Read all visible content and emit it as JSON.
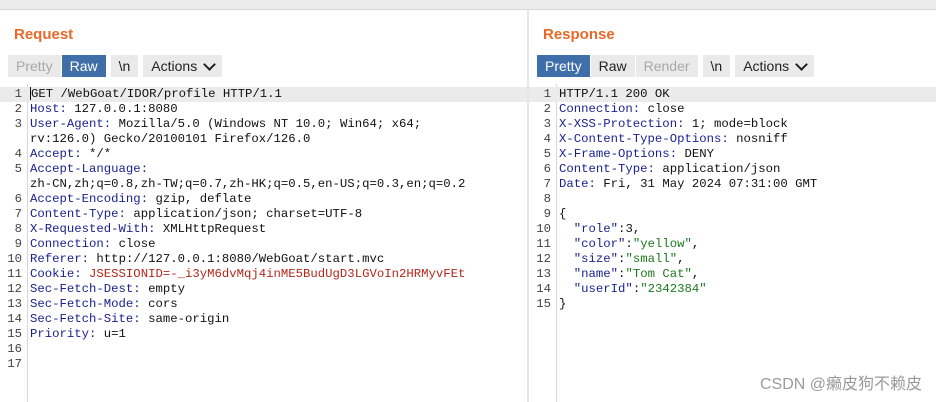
{
  "request": {
    "title": "Request",
    "tabs": [
      "Pretty",
      "Raw"
    ],
    "newline_button": "\\n",
    "actions_label": "Actions",
    "lines": [
      {
        "n": "1",
        "text": "GET /WebGoat/IDOR/profile HTTP/1.1"
      },
      {
        "n": "2",
        "key": "Host:",
        "val": " 127.0.0.1:8080"
      },
      {
        "n": "3",
        "key": "User-Agent:",
        "val": " Mozilla/5.0 (Windows NT 10.0; Win64; x64;"
      },
      {
        "n": "",
        "text": "rv:126.0) Gecko/20100101 Firefox/126.0"
      },
      {
        "n": "4",
        "key": "Accept:",
        "val": " */*"
      },
      {
        "n": "5",
        "key": "Accept-Language:",
        "val": ""
      },
      {
        "n": "",
        "text": "zh-CN,zh;q=0.8,zh-TW;q=0.7,zh-HK;q=0.5,en-US;q=0.3,en;q=0.2"
      },
      {
        "n": "6",
        "key": "Accept-Encoding:",
        "val": " gzip, deflate"
      },
      {
        "n": "7",
        "key": "Content-Type:",
        "val": " application/json; charset=UTF-8"
      },
      {
        "n": "8",
        "key": "X-Requested-With:",
        "val": " XMLHttpRequest"
      },
      {
        "n": "9",
        "key": "Connection:",
        "val": " close"
      },
      {
        "n": "10",
        "key": "Referer:",
        "val": " http://127.0.0.1:8080/WebGoat/start.mvc"
      },
      {
        "n": "11",
        "key": "Cookie:",
        "cookie": " JSESSIONID=-_i3yM6dvMqj4inME5BudUgD3LGVoIn2HRMyvFEt"
      },
      {
        "n": "12",
        "key": "Sec-Fetch-Dest:",
        "val": " empty"
      },
      {
        "n": "13",
        "key": "Sec-Fetch-Mode:",
        "val": " cors"
      },
      {
        "n": "14",
        "key": "Sec-Fetch-Site:",
        "val": " same-origin"
      },
      {
        "n": "15",
        "key": "Priority:",
        "val": " u=1"
      },
      {
        "n": "16",
        "text": ""
      },
      {
        "n": "17",
        "text": ""
      }
    ]
  },
  "response": {
    "title": "Response",
    "tabs": [
      "Pretty",
      "Raw",
      "Render"
    ],
    "newline_button": "\\n",
    "actions_label": "Actions",
    "lines": [
      {
        "n": "1",
        "text": "HTTP/1.1 200 OK"
      },
      {
        "n": "2",
        "key": "Connection:",
        "val": " close"
      },
      {
        "n": "3",
        "key": "X-XSS-Protection:",
        "val": " 1; mode=block"
      },
      {
        "n": "4",
        "key": "X-Content-Type-Options:",
        "val": " nosniff"
      },
      {
        "n": "5",
        "key": "X-Frame-Options:",
        "val": " DENY"
      },
      {
        "n": "6",
        "key": "Content-Type:",
        "val": " application/json"
      },
      {
        "n": "7",
        "key": "Date:",
        "val": " Fri, 31 May 2024 07:31:00 GMT"
      },
      {
        "n": "8",
        "text": ""
      },
      {
        "n": "9",
        "text": "{"
      },
      {
        "n": "10",
        "jkey": "\"role\"",
        "jpunct": ":",
        "jnum": "3",
        "tail": ","
      },
      {
        "n": "11",
        "jkey": "\"color\"",
        "jpunct": ":",
        "jstr": "\"yellow\"",
        "tail": ","
      },
      {
        "n": "12",
        "jkey": "\"size\"",
        "jpunct": ":",
        "jstr": "\"small\"",
        "tail": ","
      },
      {
        "n": "13",
        "jkey": "\"name\"",
        "jpunct": ":",
        "jstr": "\"Tom Cat\"",
        "tail": ","
      },
      {
        "n": "14",
        "jkey": "\"userId\"",
        "jpunct": ":",
        "jstr": "\"2342384\"",
        "tail": ""
      },
      {
        "n": "15",
        "text": "}"
      }
    ]
  },
  "watermark": "CSDN @癞皮狗不赖皮"
}
